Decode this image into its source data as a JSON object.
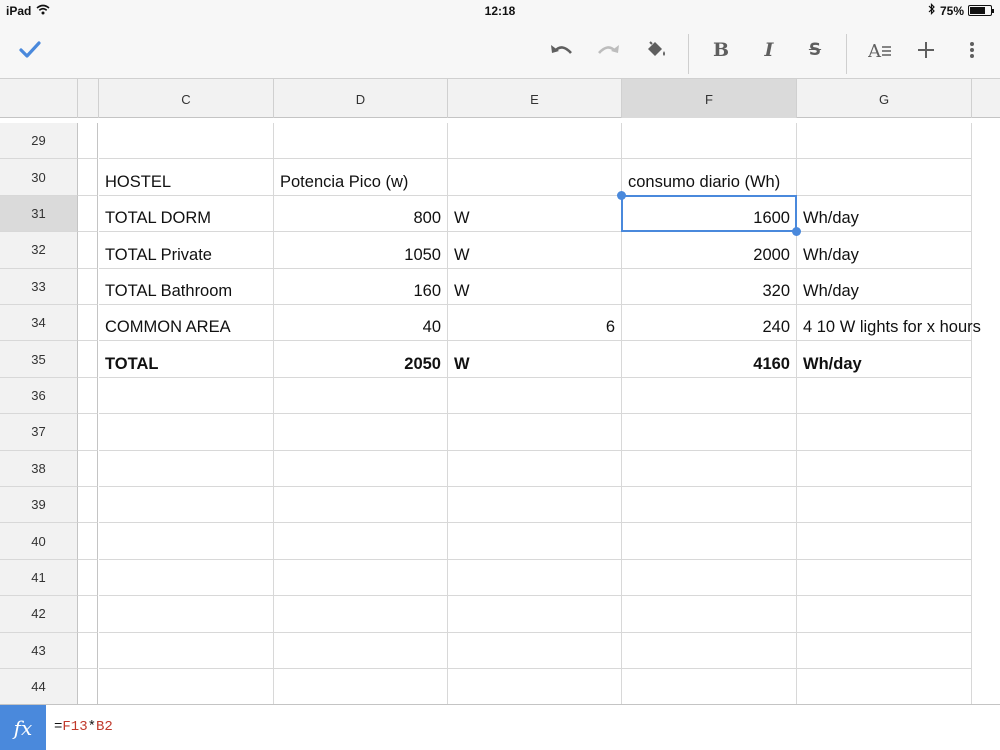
{
  "status_bar": {
    "device": "iPad",
    "time": "12:18",
    "battery": "75%",
    "battery_level": 0.75
  },
  "toolbar": {
    "done": "checkmark-icon",
    "undo": "undo-icon",
    "redo": "redo-icon",
    "fill": "paint-bucket-icon",
    "bold_label": "B",
    "italic_label": "I",
    "strike_label": "S",
    "text_format": "text-format-icon",
    "insert": "plus-icon",
    "more": "more-vertical-icon",
    "accent_color": "#4a89dc"
  },
  "columns": [
    "C",
    "D",
    "E",
    "F",
    "G"
  ],
  "selected_column": "F",
  "rows": [
    {
      "num": "29",
      "cells": [
        "",
        "",
        "",
        "",
        ""
      ]
    },
    {
      "num": "30",
      "cells": [
        "HOSTEL",
        "Potencia Pico (w)",
        "",
        "consumo diario (Wh)",
        ""
      ]
    },
    {
      "num": "31",
      "cells": [
        "TOTAL DORM",
        "800",
        "W",
        "1600",
        "Wh/day"
      ]
    },
    {
      "num": "32",
      "cells": [
        "TOTAL Private",
        "1050",
        "W",
        "2000",
        "Wh/day"
      ]
    },
    {
      "num": "33",
      "cells": [
        "TOTAL Bathroom",
        "160",
        "W",
        "320",
        "Wh/day"
      ]
    },
    {
      "num": "34",
      "cells": [
        "COMMON AREA",
        "40",
        "6",
        "240",
        "4 10 W lights for x hours"
      ]
    },
    {
      "num": "35",
      "cells": [
        "TOTAL",
        "2050",
        "W",
        "4160",
        "Wh/day"
      ]
    },
    {
      "num": "36",
      "cells": [
        "",
        "",
        "",
        "",
        ""
      ]
    },
    {
      "num": "37",
      "cells": [
        "",
        "",
        "",
        "",
        ""
      ]
    },
    {
      "num": "38",
      "cells": [
        "",
        "",
        "",
        "",
        ""
      ]
    },
    {
      "num": "39",
      "cells": [
        "",
        "",
        "",
        "",
        ""
      ]
    },
    {
      "num": "40",
      "cells": [
        "",
        "",
        "",
        "",
        ""
      ]
    },
    {
      "num": "41",
      "cells": [
        "",
        "",
        "",
        "",
        ""
      ]
    },
    {
      "num": "42",
      "cells": [
        "",
        "",
        "",
        "",
        ""
      ]
    },
    {
      "num": "43",
      "cells": [
        "",
        "",
        "",
        "",
        ""
      ]
    },
    {
      "num": "44",
      "cells": [
        "",
        "",
        "",
        "",
        ""
      ]
    }
  ],
  "selected_row": "31",
  "bold_row": "35",
  "formula_bar": {
    "fx_label": "fx",
    "eq": "=",
    "ref1": "F13",
    "op": "*",
    "ref2": "B2"
  }
}
